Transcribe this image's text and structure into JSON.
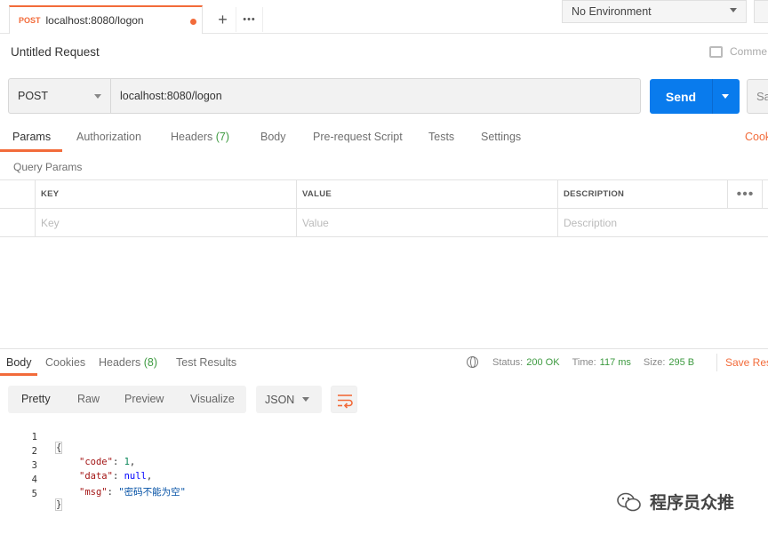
{
  "tabbar": {
    "tab_method": "POST",
    "tab_name": "localhost:8080/logon",
    "add_label": "+",
    "more_label": "•••"
  },
  "environment": {
    "selected": "No Environment"
  },
  "request": {
    "title": "Untitled Request",
    "comments_label": "Comme",
    "method": "POST",
    "url": "localhost:8080/logon",
    "send_label": "Send",
    "save_label": "Sa"
  },
  "request_tabs": [
    {
      "label": "Params"
    },
    {
      "label": "Authorization"
    },
    {
      "label": "Headers",
      "count": "(7)"
    },
    {
      "label": "Body"
    },
    {
      "label": "Pre-request Script"
    },
    {
      "label": "Tests"
    },
    {
      "label": "Settings"
    }
  ],
  "cookies_label": "Cook",
  "query_params": {
    "title": "Query Params",
    "columns": [
      "KEY",
      "VALUE",
      "DESCRIPTION"
    ],
    "placeholders": [
      "Key",
      "Value",
      "Description"
    ],
    "more_label": "•••"
  },
  "response": {
    "tabs": [
      {
        "label": "Body"
      },
      {
        "label": "Cookies"
      },
      {
        "label": "Headers",
        "count": "(8)"
      },
      {
        "label": "Test Results"
      }
    ],
    "status_label": "Status:",
    "status_value": "200 OK",
    "time_label": "Time:",
    "time_value": "117 ms",
    "size_label": "Size:",
    "size_value": "295 B",
    "save_label": "Save Res",
    "formats": [
      "Pretty",
      "Raw",
      "Preview",
      "Visualize"
    ],
    "language": "JSON",
    "code": {
      "line_numbers": [
        "1",
        "2",
        "3",
        "4",
        "5"
      ],
      "open_brace": "{",
      "close_brace": "}",
      "code_key": "\"code\"",
      "code_value": "1",
      "data_key": "\"data\"",
      "data_value": "null",
      "msg_key": "\"msg\"",
      "msg_value": "\"密码不能为空\""
    }
  },
  "watermark": {
    "text": "程序员众推"
  }
}
